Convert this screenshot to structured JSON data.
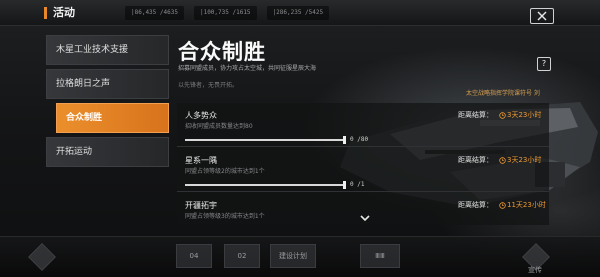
{
  "header": {
    "title": "活动",
    "resources": [
      "|86,435 /4635",
      "|100,735 /1615",
      "|286,235 /5425"
    ]
  },
  "sidebar": {
    "items": [
      {
        "label": "木星工业技术支援"
      },
      {
        "label": "拉格朗日之声"
      },
      {
        "label": "合众制胜"
      },
      {
        "label": "开拓运动"
      }
    ]
  },
  "main": {
    "title": "合众制胜",
    "subtitle": "招募同盟成员，协力攻占太空城，共同征服星辰大海",
    "subtitle2": "以先锋者，无畏开拓。",
    "guild_tag": "太空战略指挥学院课符号 刘",
    "help": "?"
  },
  "tasks": [
    {
      "name": "人多势众",
      "desc": "招收同盟成员数量达到80",
      "progress": "0 /80",
      "fill": 0,
      "timer_label": "距离结算：",
      "timer": "3天23小时"
    },
    {
      "name": "星系一隅",
      "desc": "同盟占领等级2的城市达到1个",
      "progress": "0 /1",
      "fill": 0,
      "timer_label": "距离结算：",
      "timer": "3天23小时"
    },
    {
      "name": "开疆拓宇",
      "desc": "同盟占领等级3的城市达到1个",
      "progress": "",
      "fill": 0,
      "timer_label": "距离结算：",
      "timer": "11天23小时"
    }
  ],
  "bottom": {
    "labels": [
      "04",
      "02",
      "建设计划",
      "ⅢⅢ",
      "宣传"
    ]
  },
  "colors": {
    "accent": "#eb8f2c",
    "timer": "#ef9a34",
    "bar": "#d8d8d8"
  }
}
